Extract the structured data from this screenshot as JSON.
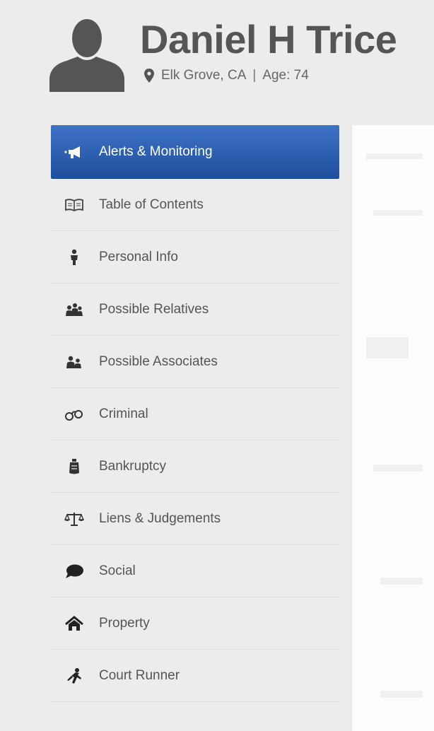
{
  "profile": {
    "name": "Daniel H Trice",
    "location": "Elk Grove, CA",
    "separator": "|",
    "age_text": "Age: 74"
  },
  "colors": {
    "active_bg": "#2f5fb3",
    "icon": "#444444",
    "name_text": "#555555"
  },
  "nav": {
    "items": [
      {
        "label": "Alerts & Monitoring",
        "icon": "megaphone-icon",
        "active": true
      },
      {
        "label": "Table of Contents",
        "icon": "book-icon"
      },
      {
        "label": "Personal Info",
        "icon": "person-icon"
      },
      {
        "label": "Possible Relatives",
        "icon": "family-icon"
      },
      {
        "label": "Possible Associates",
        "icon": "associates-icon"
      },
      {
        "label": "Criminal",
        "icon": "handcuffs-icon"
      },
      {
        "label": "Bankruptcy",
        "icon": "piggy-bank-icon"
      },
      {
        "label": "Liens & Judgements",
        "icon": "scales-icon"
      },
      {
        "label": "Social",
        "icon": "speech-bubble-icon"
      },
      {
        "label": "Property",
        "icon": "home-icon"
      },
      {
        "label": "Court Runner",
        "icon": "runner-icon"
      }
    ]
  }
}
